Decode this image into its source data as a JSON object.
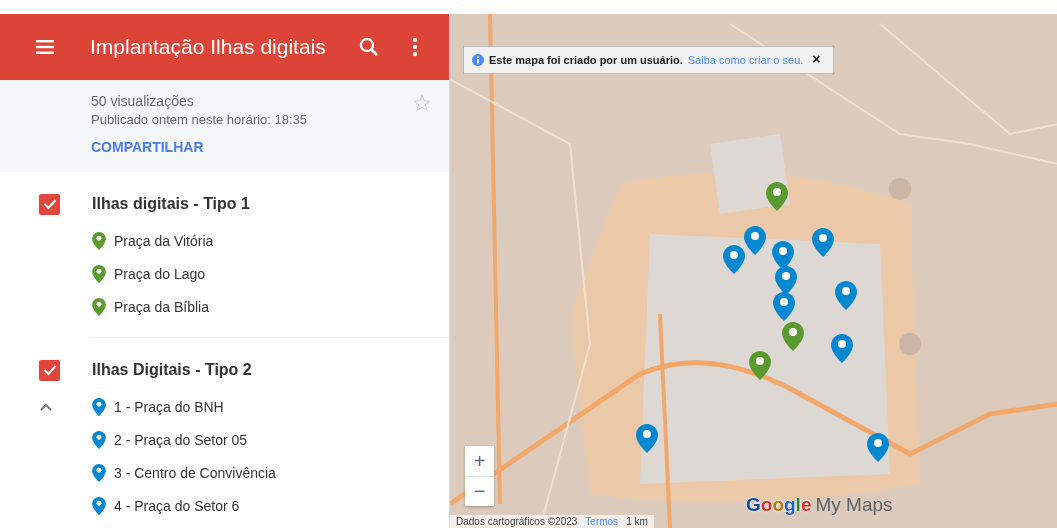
{
  "header": {
    "title": "Implantação Ilhas digitais"
  },
  "info": {
    "views": "50 visualizações",
    "published": "Publicado ontem neste horário: 18:35",
    "share": "COMPARTILHAR",
    "starred": false
  },
  "layers": [
    {
      "name": "Ilhas digitais - Tipo 1",
      "checked": true,
      "hovered": false,
      "color": "#5b9a2f",
      "items": [
        "Praça da Vitória",
        "Praça do Lago",
        "Praça da Bíblia"
      ]
    },
    {
      "name": "Ilhas Digitais - Tipo 2",
      "checked": true,
      "hovered": true,
      "color": "#0288d1",
      "items": [
        "1 - Praça do BNH",
        "2 - Praça do Setor 05",
        "3 - Centro de Convivência",
        "4 - Praça do Setor 6"
      ]
    }
  ],
  "map": {
    "notice": {
      "text": "Este mapa foi criado por um usuário.",
      "link": "Saiba como criar o seu.",
      "close": "×"
    },
    "zoom_in": "+",
    "zoom_out": "−",
    "logo": {
      "brand": "Google",
      "product": "My Maps"
    },
    "attribution": {
      "data": "Dados cartográficos ©2023",
      "terms": "Termos",
      "scale": "1 km"
    }
  }
}
